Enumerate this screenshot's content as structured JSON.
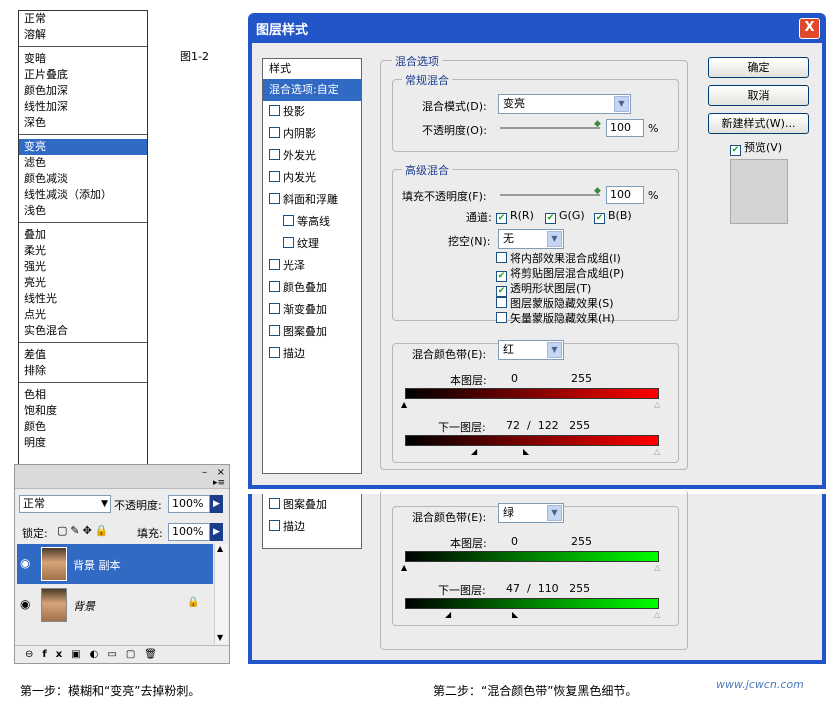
{
  "figure_label": "图1-2",
  "blend_menu": {
    "groups": [
      [
        "正常",
        "溶解"
      ],
      [
        "变暗",
        "正片叠底",
        "颜色加深",
        "线性加深",
        "深色"
      ],
      [
        "变亮",
        "滤色",
        "颜色减淡",
        "线性减淡（添加）",
        "浅色"
      ],
      [
        "叠加",
        "柔光",
        "强光",
        "亮光",
        "线性光",
        "点光",
        "实色混合"
      ],
      [
        "差值",
        "排除"
      ],
      [
        "色相",
        "饱和度",
        "颜色",
        "明度"
      ]
    ],
    "selected": "变亮"
  },
  "layers_panel": {
    "mode": "正常",
    "opacity_label": "不透明度:",
    "opacity": "100%",
    "lock_label": "锁定:",
    "fill_label": "填充:",
    "fill": "100%",
    "layers": [
      "背景 副本",
      "背景"
    ]
  },
  "dialog": {
    "title": "图层样式",
    "close": "X",
    "styles_header": "样式",
    "styles": [
      "混合选项:自定",
      "投影",
      "内阴影",
      "外发光",
      "内发光",
      "斜面和浮雕",
      "等高线",
      "纹理",
      "光泽",
      "颜色叠加",
      "渐变叠加",
      "图案叠加",
      "描边"
    ],
    "blend_options": "混合选项",
    "general_blending": "常规混合",
    "blend_mode_label": "混合模式(D):",
    "blend_mode": "变亮",
    "opacity_label": "不透明度(O):",
    "opacity": "100",
    "percent": "%",
    "advanced_blending": "高级混合",
    "fill_opacity_label": "填充不透明度(F):",
    "fill_opacity": "100",
    "channels_label": "通道:",
    "channel_r": "R(R)",
    "channel_g": "G(G)",
    "channel_b": "B(B)",
    "knockout_label": "挖空(N):",
    "knockout": "无",
    "options": [
      {
        "label": "将内部效果混合成组(I)",
        "checked": false
      },
      {
        "label": "将剪贴图层混合成组(P)",
        "checked": true
      },
      {
        "label": "透明形状图层(T)",
        "checked": true
      },
      {
        "label": "图层蒙版隐藏效果(S)",
        "checked": false
      },
      {
        "label": "矢量蒙版隐藏效果(H)",
        "checked": false
      }
    ],
    "blend_if_label": "混合颜色带(E):",
    "blend_if": "红",
    "this_layer_label": "本图层:",
    "this_layer_min": "0",
    "this_layer_max": "255",
    "underlying_label": "下一图层:",
    "underlying": "72  /  122   255",
    "ok": "确定",
    "cancel": "取消",
    "new_style": "新建样式(W)...",
    "preview": "预览(V)"
  },
  "dialog2": {
    "styles": [
      "图案叠加",
      "描边"
    ],
    "blend_if_label": "混合颜色带(E):",
    "blend_if": "绿",
    "this_layer_label": "本图层:",
    "this_layer_min": "0",
    "this_layer_max": "255",
    "underlying_label": "下一图层:",
    "underlying": "47  /  110   255"
  },
  "captions": {
    "step1": "第一步：模糊和“变亮”去掉粉刺。",
    "step2": "第二步：“混合颜色带”恢复黑色细节。"
  },
  "watermark": "www.jcwcn.com",
  "colors": {
    "accent": "#316ac5",
    "title_bar": "#2155c8",
    "red": "#ff0000",
    "green": "#00ff00"
  }
}
